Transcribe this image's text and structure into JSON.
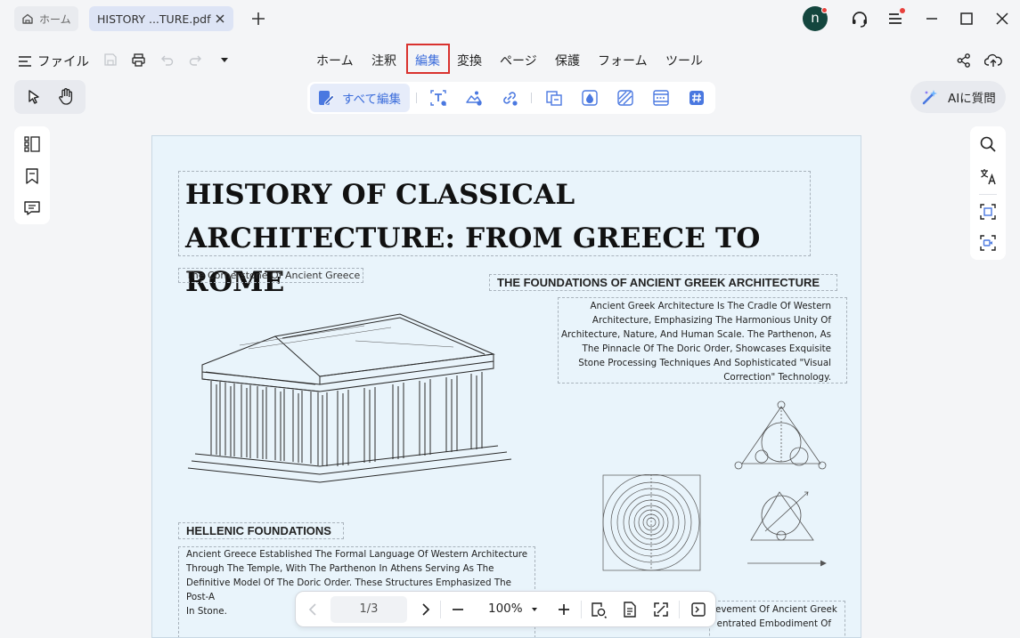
{
  "tabs": {
    "home_label": "ホーム",
    "document_label": "HISTORY ...TURE.pdf"
  },
  "account": {
    "avatar_initial": "n"
  },
  "menubar": {
    "file_label": "ファイル",
    "items": [
      "ホーム",
      "注釈",
      "編集",
      "変換",
      "ページ",
      "保護",
      "フォーム",
      "ツール"
    ],
    "active_item": "編集"
  },
  "toolbar": {
    "edit_all_label": "すべて編集",
    "ai_label": "AIに質問",
    "accent_color": "#3c6ddb"
  },
  "document": {
    "title": "HISTORY OF CLASSICAL  ARCHITECTURE: FROM GREECE TO ROME",
    "subtitle": "The Cornerstone Of Ancient Greece",
    "heading_1": "THE FOUNDATIONS OF ANCIENT GREEK ARCHITECTURE",
    "paragraph_1": "Ancient Greek Architecture Is The Cradle Of Western Architecture, Emphasizing The Harmonious Unity Of Architecture, Nature, And Human Scale. The Parthenon, As The Pinnacle Of The Doric Order, Showcases Exquisite Stone Processing Techniques And Sophisticated \"Visual Correction\" Technology.",
    "heading_2": "HELLENIC FOUNDATIONS",
    "paragraph_2": "Ancient Greece Established The Formal Language Of Western Architecture Through The Temple, With The Parthenon In Athens Serving As The Definitive Model Of The Doric Order. These Structures Emphasized The Post-A",
    "paragraph_2_end": "In Stone.",
    "paragraph_3_line1": "evement Of Ancient Greek",
    "paragraph_3_line2": "entrated Embodiment Of"
  },
  "navigation": {
    "page_indicator": "1/3",
    "zoom_level": "100%"
  }
}
